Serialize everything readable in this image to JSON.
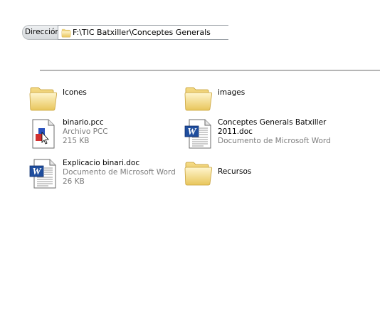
{
  "address": {
    "label": "Dirección",
    "path": "F:\\TIC Batxiller\\Conceptes Generals"
  },
  "items": [
    {
      "name": "Icones",
      "type": "",
      "size": "",
      "icon": "folder-icon"
    },
    {
      "name": "images",
      "type": "",
      "size": "",
      "icon": "folder-icon"
    },
    {
      "name": "binario.pcc",
      "type": "Archivo PCC",
      "size": "215 KB",
      "icon": "publisher-file-icon"
    },
    {
      "name_line1": "Conceptes Generals Batxiller",
      "name_line2": "2011.doc",
      "type": "Documento de Microsoft Word",
      "size": "",
      "icon": "word-document-icon"
    },
    {
      "name": "Explicacio binari.doc",
      "type": "Documento de Microsoft Word",
      "size": "26 KB",
      "icon": "word-document-icon"
    },
    {
      "name": "Recursos",
      "type": "",
      "size": "",
      "icon": "folder-icon"
    }
  ]
}
